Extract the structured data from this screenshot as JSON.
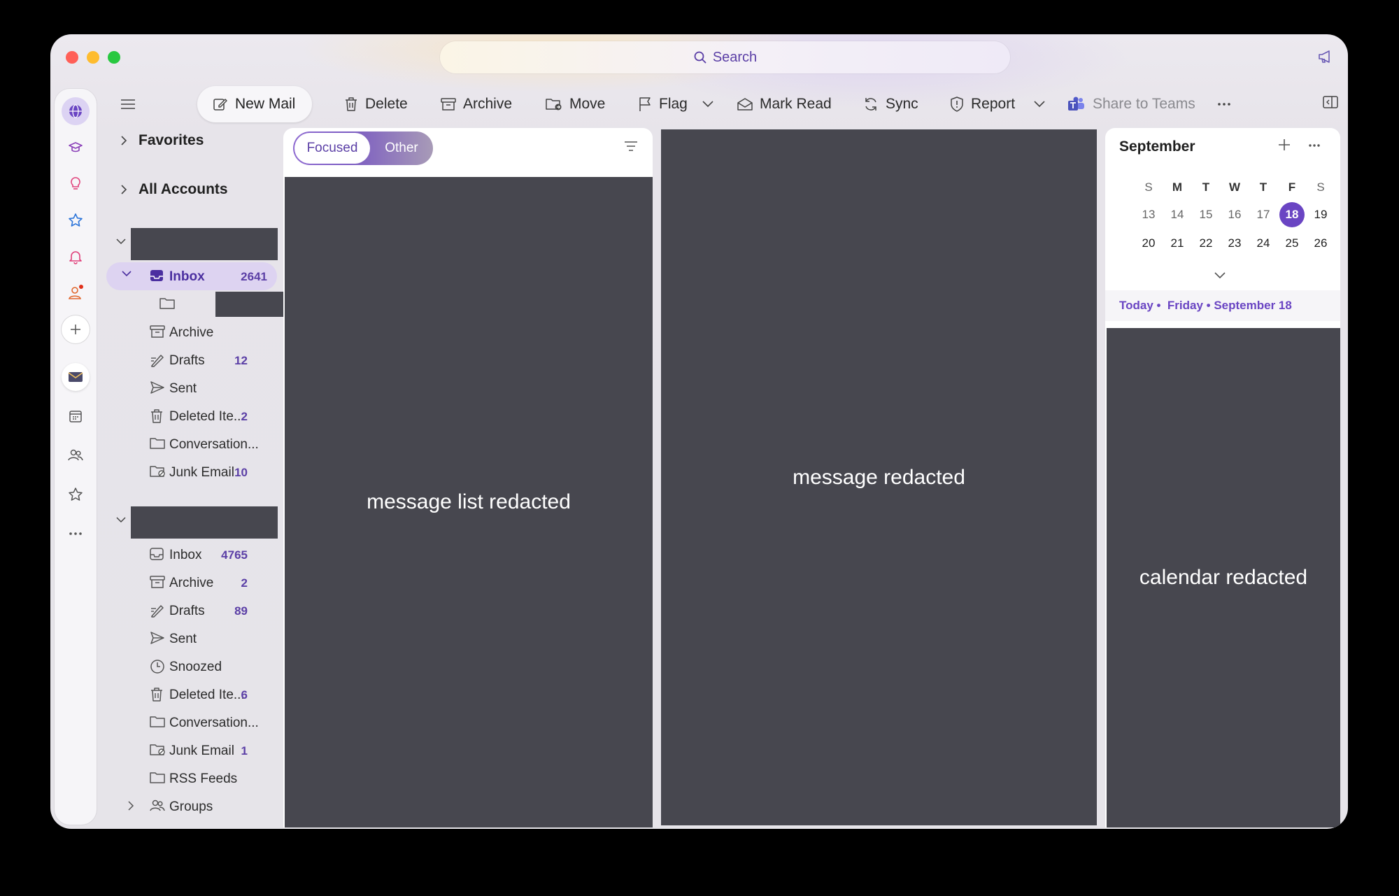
{
  "search": {
    "label": "Search"
  },
  "toolbar": {
    "new_mail": "New Mail",
    "delete": "Delete",
    "archive": "Archive",
    "move": "Move",
    "flag": "Flag",
    "mark_read": "Mark Read",
    "sync": "Sync",
    "report": "Report",
    "share_to_teams": "Share to Teams"
  },
  "sidebar": {
    "favorites": "Favorites",
    "all_accounts": "All Accounts",
    "account1": {
      "folders": [
        {
          "label": "Inbox",
          "count": "2641",
          "icon": "inbox-icon",
          "selected": true
        },
        {
          "label": "",
          "count": "",
          "icon": "folder-icon",
          "redacted": true
        },
        {
          "label": "Archive",
          "count": "",
          "icon": "archive-icon"
        },
        {
          "label": "Drafts",
          "count": "12",
          "icon": "drafts-icon"
        },
        {
          "label": "Sent",
          "count": "",
          "icon": "sent-icon"
        },
        {
          "label": "Deleted Ite...",
          "count": "2",
          "icon": "trash-icon"
        },
        {
          "label": "Conversation...",
          "count": "",
          "icon": "folder-icon"
        },
        {
          "label": "Junk Email",
          "count": "10",
          "icon": "junk-icon"
        }
      ]
    },
    "account2": {
      "folders": [
        {
          "label": "Inbox",
          "count": "4765",
          "icon": "inbox-icon"
        },
        {
          "label": "Archive",
          "count": "2",
          "icon": "archive-icon"
        },
        {
          "label": "Drafts",
          "count": "89",
          "icon": "drafts-icon"
        },
        {
          "label": "Sent",
          "count": "",
          "icon": "sent-icon"
        },
        {
          "label": "Snoozed",
          "count": "",
          "icon": "clock-icon"
        },
        {
          "label": "Deleted Ite...",
          "count": "6",
          "icon": "trash-icon"
        },
        {
          "label": "Conversation...",
          "count": "",
          "icon": "folder-icon"
        },
        {
          "label": "Junk Email",
          "count": "1",
          "icon": "junk-icon"
        },
        {
          "label": "RSS Feeds",
          "count": "",
          "icon": "folder-icon"
        },
        {
          "label": "Groups",
          "count": "",
          "icon": "groups-icon"
        }
      ]
    }
  },
  "message_list": {
    "tab_focused": "Focused",
    "tab_other": "Other",
    "redacted_text": "message list redacted"
  },
  "reading_pane": {
    "redacted_text": "message redacted"
  },
  "calendar": {
    "month": "September",
    "weekdays": [
      "S",
      "M",
      "T",
      "W",
      "T",
      "F",
      "S"
    ],
    "week1": [
      "13",
      "14",
      "15",
      "16",
      "17",
      "18",
      "19"
    ],
    "week2": [
      "20",
      "21",
      "22",
      "23",
      "24",
      "25",
      "26"
    ],
    "today_label": "Today •  Friday • September 18",
    "redacted_text": "calendar redacted",
    "accent": "#6a45c3"
  },
  "colors": {
    "accent": "#5b3fa6",
    "selected_bg": "#ddd3f1",
    "redacted": "#47474f"
  }
}
